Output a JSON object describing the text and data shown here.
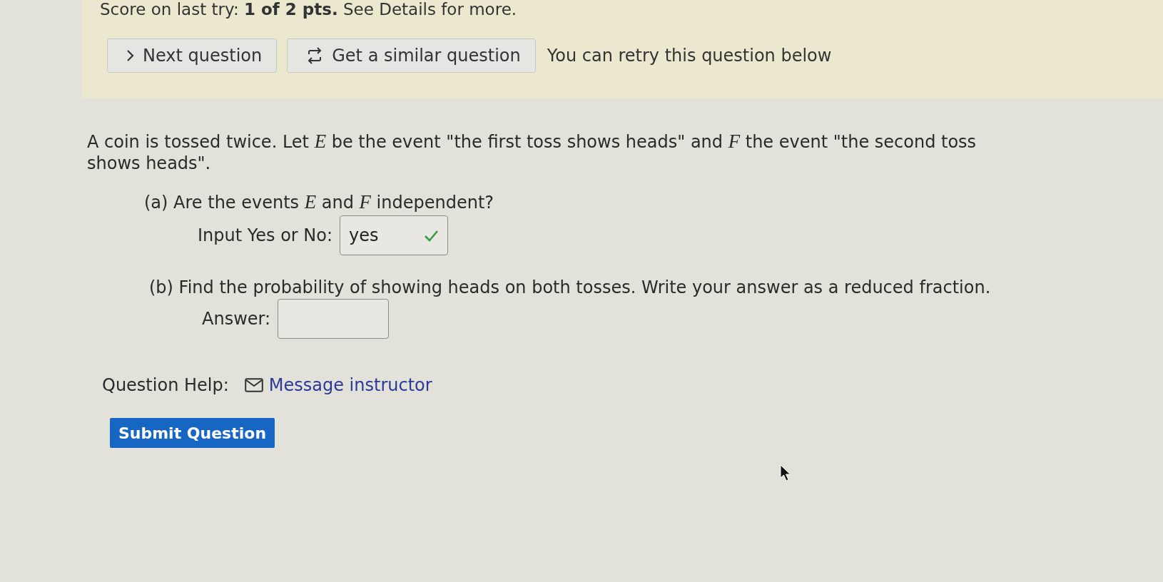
{
  "score_line": "Score on last try: **1 of 2 pts.** See Details for more.",
  "actions": [
    {
      "kind": "next",
      "label": "Next question"
    },
    {
      "kind": "similar",
      "label": "Get a similar question"
    }
  ],
  "retry_note": "You can retry this question below",
  "question": {
    "text": "A coin is tossed twice. Let *E* be the event \"the first toss shows heads\" and *F* the event \"the second toss shows heads\".",
    "parts": [
      {
        "prompt": "(a) Are the events *E* and *F* independent?",
        "field_label": "Input Yes or No:",
        "value": "yes",
        "correct": true
      },
      {
        "prompt": "(b) Find the probability of showing heads on both tosses. Write your answer as a reduced fraction.",
        "field_label": "Answer:"
      }
    ]
  },
  "help": {
    "label": "Question Help:",
    "link": "Message instructor"
  },
  "submit": {
    "label": "Submit Question"
  }
}
